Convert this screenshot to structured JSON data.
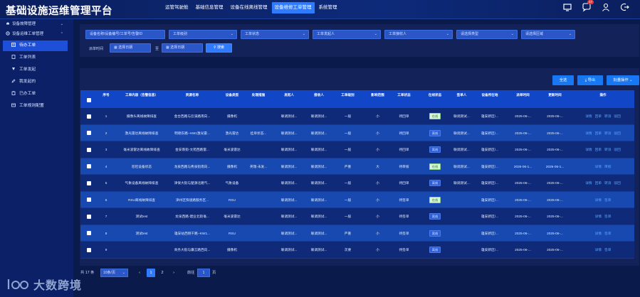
{
  "header": {
    "title": "基础设施运维管理平台",
    "nav": [
      {
        "label": "运管驾驶舱",
        "active": false
      },
      {
        "label": "基础信息管理",
        "active": false
      },
      {
        "label": "设备在线离线管理",
        "active": false
      },
      {
        "label": "设备维修工单管理",
        "active": true
      },
      {
        "label": "系统管理",
        "active": false
      }
    ],
    "notification_count": "17"
  },
  "sidebar": {
    "groups": [
      {
        "label": "设备故障管理",
        "expanded": false
      },
      {
        "label": "设备运维工单管理",
        "expanded": true
      }
    ],
    "items": [
      {
        "label": "待办工单",
        "active": true
      },
      {
        "label": "工单列表",
        "active": false
      },
      {
        "label": "工单发起",
        "active": false
      },
      {
        "label": "我发起的",
        "active": false
      },
      {
        "label": "已办工单",
        "active": false
      },
      {
        "label": "工单规则配置",
        "active": false
      }
    ]
  },
  "watermark": {
    "text": "大数跨境"
  },
  "filters": {
    "keyword_placeholder": "设备名称/设备编号/工单号/告警ID",
    "level_placeholder": "工单级别",
    "status_placeholder": "工单状态",
    "initiator_placeholder": "工单发起人",
    "receiver_placeholder": "工单接收人",
    "type_placeholder": "请选择类型",
    "area_placeholder": "请选择区域",
    "time_label": "派单时间",
    "start_placeholder": "选择日期",
    "to_label": "至",
    "end_placeholder": "选择日期",
    "search_label": "搜索"
  },
  "actions": {
    "select_all": "全选",
    "export": "导出",
    "batch": "批量操作"
  },
  "table": {
    "headers": [
      "序号",
      "工单内容（告警信息）",
      "资源名称",
      "设备类型",
      "处理措施",
      "发起人",
      "接收人",
      "工单级别",
      "影响范围",
      "工单状态",
      "在线状态",
      "签单人",
      "设备所在地",
      "派单时间",
      "更新时间",
      "操作"
    ],
    "rows": [
      {
        "no": "1",
        "content": "摄像头离线故障排查",
        "resource": "金台西路与云溪路南向...",
        "type": "摄像机",
        "measure": "",
        "initiator": "联调测试...",
        "receiver": "联调测试...",
        "level": "一般",
        "scope": "小",
        "status": "待回单",
        "online": "在线",
        "signer": "联调测试...",
        "location": "雄安新区/...",
        "dispatch": "2025-06-...",
        "update": "2025-06-...",
        "ops": [
          "详情",
          "回单",
          "转派",
          "驳回"
        ]
      },
      {
        "no": "2",
        "content": "激光雷达离线故障排查",
        "resource": "明德东路--HM1激光雷...",
        "type": "激光雷达",
        "measure": "挂单状态...",
        "initiator": "联调测试...",
        "receiver": "联调测试...",
        "level": "一般",
        "scope": "小",
        "status": "待回单",
        "online": "离线",
        "signer": "联调测试...",
        "location": "雄安新区/...",
        "dispatch": "2025-06-...",
        "update": "2025-06-...",
        "ops": [
          "详情",
          "回单",
          "转派",
          "驳回"
        ]
      },
      {
        "no": "3",
        "content": "毫米波雷达离线故障排查",
        "resource": "金安南街-文苑西路雷...",
        "type": "毫米波雷达",
        "measure": "",
        "initiator": "联调测试...",
        "receiver": "联调测试...",
        "level": "一般",
        "scope": "小",
        "status": "待回单",
        "online": "离线",
        "signer": "联调测试...",
        "location": "雄安新区/...",
        "dispatch": "2025-06-...",
        "update": "2025-06-...",
        "ops": [
          "详情",
          "回单",
          "转派",
          "驳回"
        ]
      },
      {
        "no": "4",
        "content": "巡检设备状态",
        "resource": "龙泉西路与秀泉街南向...",
        "type": "摄像机",
        "measure": "英瑞-未发...",
        "initiator": "联调测试...",
        "receiver": "联调测试...",
        "level": "严重",
        "scope": "大",
        "status": "待审核",
        "online": "在线",
        "signer": "联调测试...",
        "location": "雄安新区/...",
        "dispatch": "2025-06-1...",
        "update": "2025-06-1...",
        "ops": [
          "详情",
          "审核"
        ]
      },
      {
        "no": "5",
        "content": "气象设备离线故障排查",
        "resource": "津保大街与楚源北路气...",
        "type": "气象设备",
        "measure": "",
        "initiator": "联调测试...",
        "receiver": "联调测试...",
        "level": "一般",
        "scope": "小",
        "status": "待回单",
        "online": "离线",
        "signer": "联调测试...",
        "location": "雄安新区/...",
        "dispatch": "2025-06-...",
        "update": "2025-06-...",
        "ops": [
          "详情",
          "回单",
          "转派",
          "驳回"
        ]
      },
      {
        "no": "6",
        "content": "RSU离线故障排查",
        "resource": "津州区快速路服务区...",
        "type": "RSU",
        "measure": "",
        "initiator": "联调测试...",
        "receiver": "联调测试...",
        "level": "一般",
        "scope": "小",
        "status": "待签单",
        "online": "在线",
        "signer": "",
        "location": "雄安新区/...",
        "dispatch": "2025-06-...",
        "update": "2025-06-...",
        "ops": [
          "详情",
          "签单"
        ]
      },
      {
        "no": "7",
        "content": "测试test",
        "resource": "龙泉西路-建业北街毫...",
        "type": "毫米波雷达",
        "measure": "",
        "initiator": "联调测试...",
        "receiver": "联调测试...",
        "level": "一般",
        "scope": "小",
        "status": "待签单",
        "online": "离线",
        "signer": "",
        "location": "雄安新区/...",
        "dispatch": "2025-06-...",
        "update": "2025-06-...",
        "ops": [
          "详情",
          "签单"
        ]
      },
      {
        "no": "8",
        "content": "测试test",
        "resource": "雄安站西侧干路--KW1...",
        "type": "RSU",
        "measure": "",
        "initiator": "联调测试...",
        "receiver": "联调测试...",
        "level": "严重",
        "scope": "小",
        "status": "待签单",
        "online": "离线",
        "signer": "",
        "location": "雄安新区/...",
        "dispatch": "2025-06-...",
        "update": "2025-06-...",
        "ops": [
          "详情",
          "签单"
        ]
      },
      {
        "no": "9",
        "content": "",
        "resource": "商务大街与廉言路西向...",
        "type": "摄像机",
        "measure": "",
        "initiator": "联调测试...",
        "receiver": "联调测试...",
        "level": "次要",
        "scope": "小",
        "status": "待签单",
        "online": "离线",
        "signer": "",
        "location": "雄安新区/...",
        "dispatch": "2025-06-...",
        "update": "2025-06-...",
        "ops": [
          "详情",
          "签单"
        ]
      }
    ]
  },
  "pagination": {
    "total": "共 17 条",
    "page_size": "10条/页",
    "pages": [
      "1",
      "2"
    ],
    "current": "1",
    "goto_label": "前往",
    "goto_value": "1",
    "page_unit": "页"
  },
  "colors": {
    "bg": "#0a1a4a",
    "sidebar": "#0b2066",
    "accent": "#2f7bff",
    "online": "#1c8a1c",
    "link": "#5da8ff"
  }
}
